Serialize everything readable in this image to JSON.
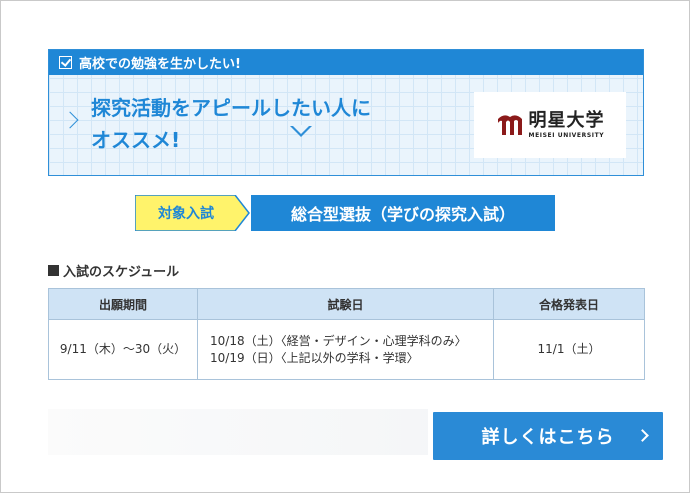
{
  "card": {
    "header": "高校での勉強を生かしたい!",
    "title_line1": "探究活動をアピールしたい人に",
    "title_line2": "オススメ!"
  },
  "logo": {
    "name": "明星大学",
    "sub": "MEISEI UNIVERSITY"
  },
  "admission": {
    "target_label": "対象入試",
    "type": "総合型選抜（学びの探究入試）"
  },
  "schedule": {
    "title": "入試のスケジュール",
    "headers": [
      "出願期間",
      "試験日",
      "合格発表日"
    ],
    "row": {
      "application": "9/11（木）〜30（火）",
      "exam_line1": "10/18（土）〈経営・デザイン・心理学科のみ〉",
      "exam_line2": "10/19（日）〈上記以外の学科・学環〉",
      "result": "11/1（土）"
    }
  },
  "cta": {
    "label": "詳しくはこちら"
  },
  "colors": {
    "accent": "#1f87d6",
    "grid_bg": "#eaf4fc",
    "tag_yellow": "#fff36b",
    "table_head": "#cfe3f5",
    "logo_red": "#8b1a1a"
  },
  "icons": [
    "check-icon",
    "chevron-right-icon",
    "square-bullet-icon",
    "cta-chevron-icon"
  ]
}
